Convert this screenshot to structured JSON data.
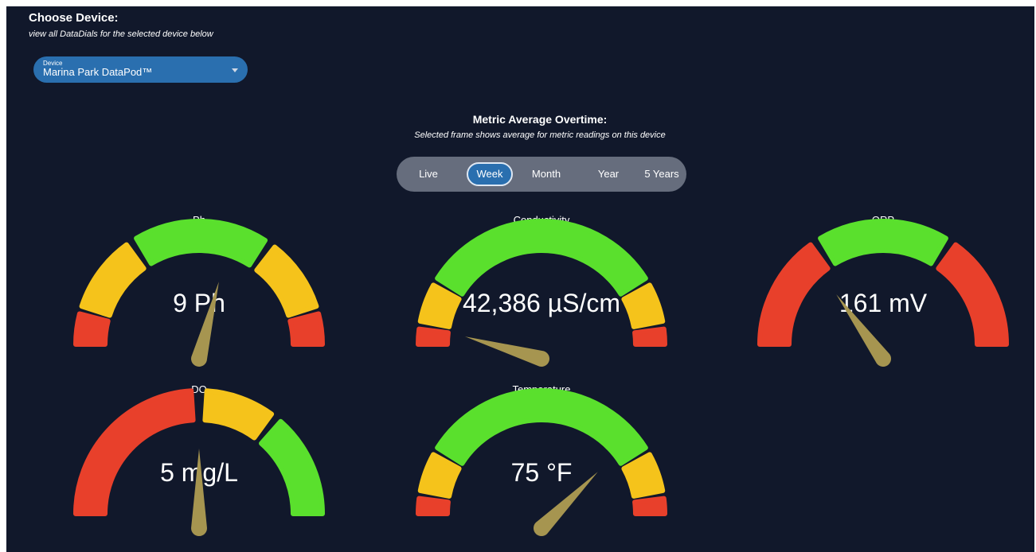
{
  "device": {
    "heading": "Choose Device:",
    "subheading": "view all DataDials for the selected device below",
    "field_label": "Device",
    "selected": "Marina Park DataPod™"
  },
  "metric": {
    "heading": "Metric Average Overtime:",
    "subheading": "Selected frame shows average for metric readings on this device",
    "tabs": [
      {
        "label": "Live"
      },
      {
        "label": "Week"
      },
      {
        "label": "Month"
      },
      {
        "label": "Year"
      },
      {
        "label": "5 Years"
      }
    ],
    "active_tab": "Week"
  },
  "colors": {
    "background": "#11182b",
    "green": "#5ae02d",
    "yellow": "#f5c31b",
    "red": "#e8402b",
    "needle": "#a69550",
    "accent": "#2a6faf"
  },
  "gauges": [
    {
      "title": "Ph",
      "value_text": "9 Ph",
      "needle_fraction": 0.58,
      "segments": [
        {
          "color": "red",
          "from": 0.0,
          "to": 0.08
        },
        {
          "color": "yellow",
          "from": 0.1,
          "to": 0.3
        },
        {
          "color": "green",
          "from": 0.33,
          "to": 0.68
        },
        {
          "color": "yellow",
          "from": 0.71,
          "to": 0.9
        },
        {
          "color": "red",
          "from": 0.92,
          "to": 1.0
        }
      ]
    },
    {
      "title": "Conductivity",
      "value_text": "42,386 µS/cm",
      "needle_fraction": 0.09,
      "segments": [
        {
          "color": "red",
          "from": 0.0,
          "to": 0.04
        },
        {
          "color": "yellow",
          "from": 0.06,
          "to": 0.16
        },
        {
          "color": "green",
          "from": 0.18,
          "to": 0.82
        },
        {
          "color": "yellow",
          "from": 0.84,
          "to": 0.94
        },
        {
          "color": "red",
          "from": 0.96,
          "to": 1.0
        }
      ]
    },
    {
      "title": "ORP",
      "value_text": "161 mV",
      "needle_fraction": 0.3,
      "segments": [
        {
          "color": "red",
          "from": 0.0,
          "to": 0.3
        },
        {
          "color": "green",
          "from": 0.33,
          "to": 0.67
        },
        {
          "color": "red",
          "from": 0.7,
          "to": 1.0
        }
      ]
    },
    {
      "title": "DO",
      "value_text": "5 mg/L",
      "needle_fraction": 0.5,
      "segments": [
        {
          "color": "red",
          "from": 0.0,
          "to": 0.48
        },
        {
          "color": "yellow",
          "from": 0.52,
          "to": 0.7
        },
        {
          "color": "green",
          "from": 0.73,
          "to": 1.0
        }
      ]
    },
    {
      "title": "Temperature",
      "value_text": "75 °F",
      "needle_fraction": 0.75,
      "segments": [
        {
          "color": "red",
          "from": 0.0,
          "to": 0.04
        },
        {
          "color": "yellow",
          "from": 0.06,
          "to": 0.16
        },
        {
          "color": "green",
          "from": 0.18,
          "to": 0.82
        },
        {
          "color": "yellow",
          "from": 0.84,
          "to": 0.94
        },
        {
          "color": "red",
          "from": 0.96,
          "to": 1.0
        }
      ]
    }
  ]
}
